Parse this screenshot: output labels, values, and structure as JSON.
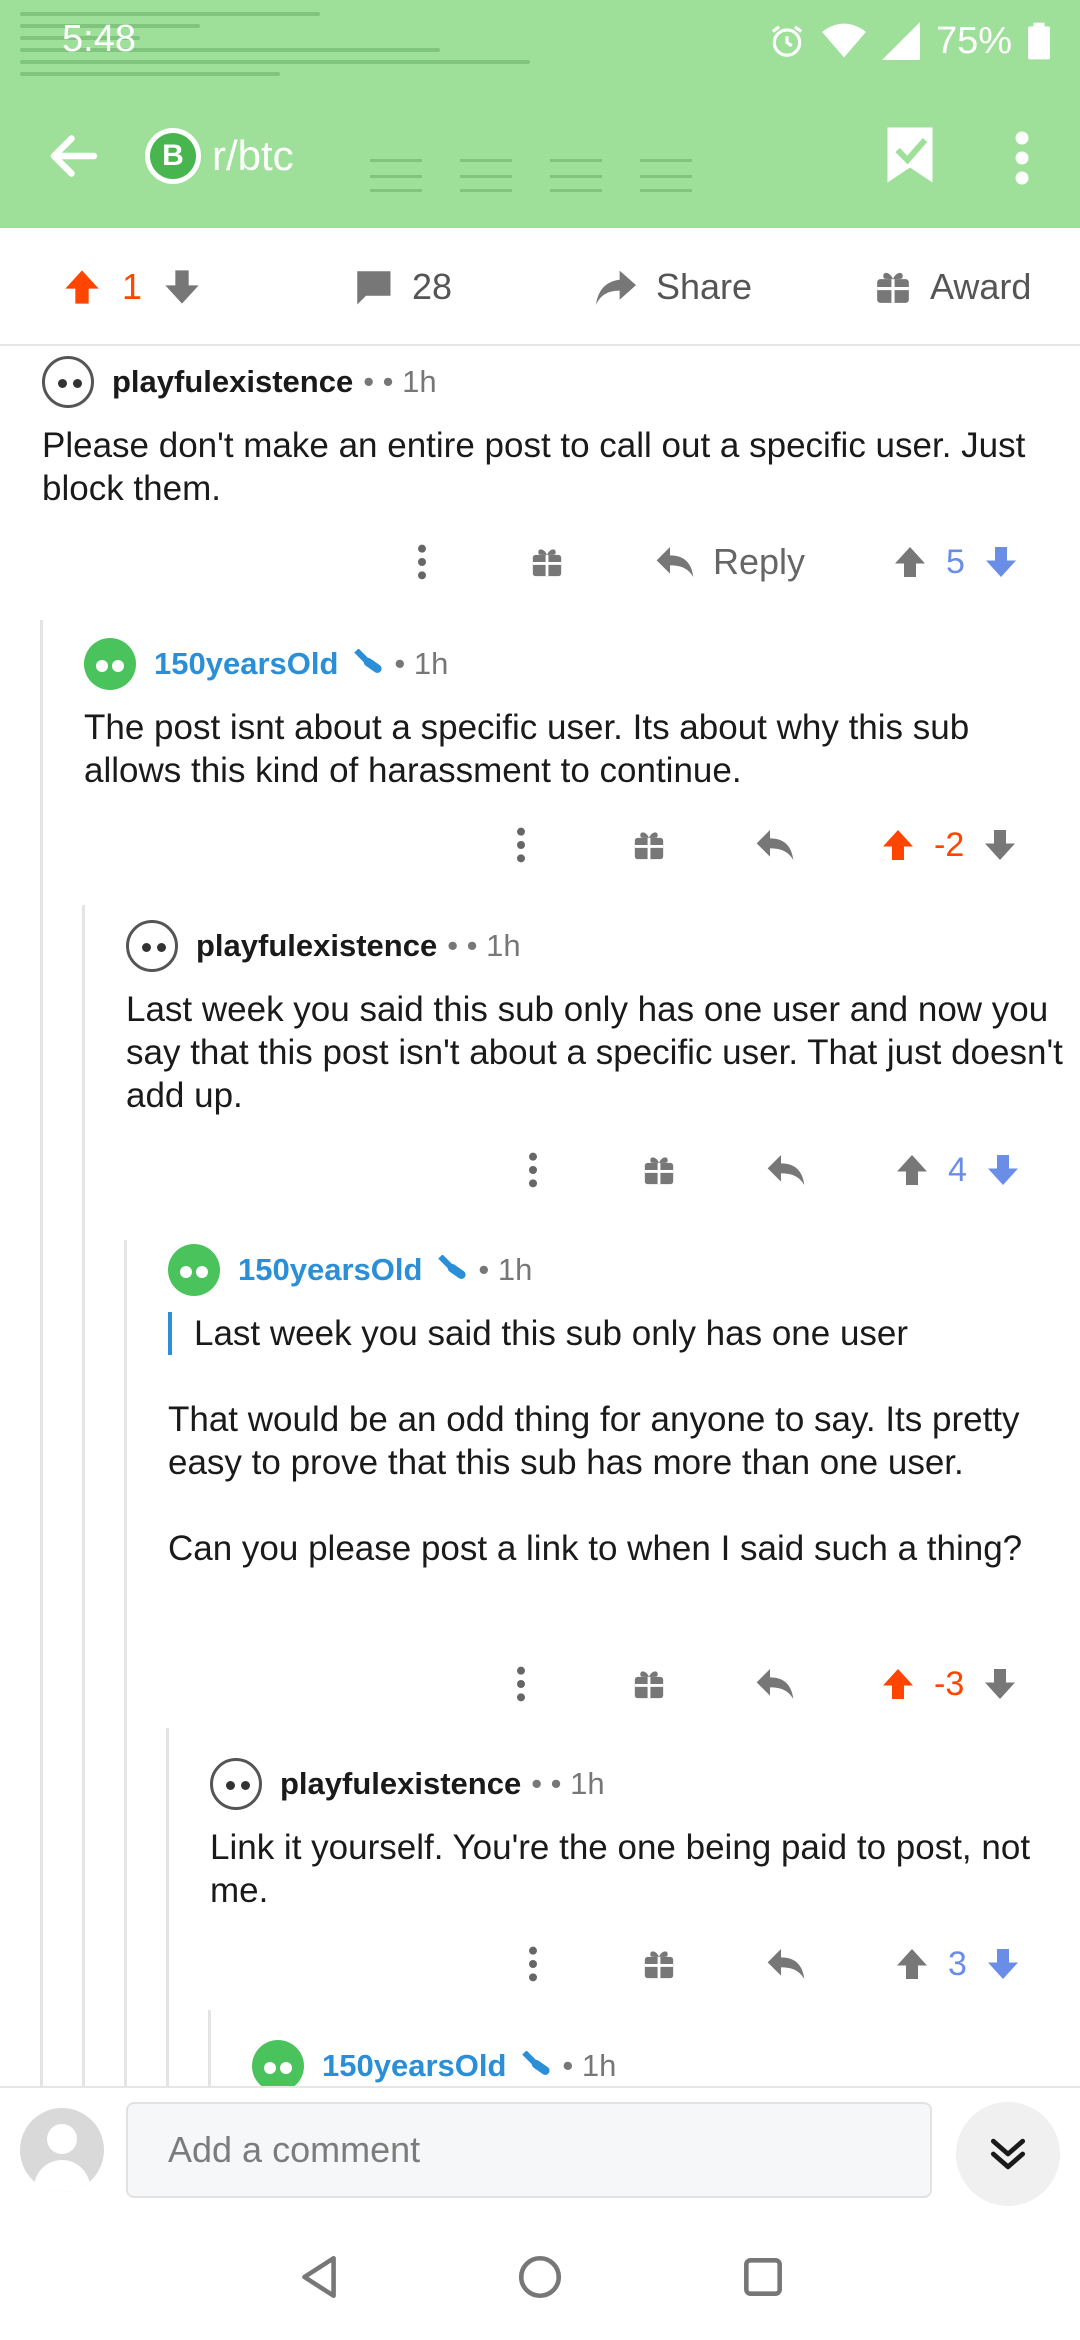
{
  "status": {
    "time": "5:48",
    "battery": "75%"
  },
  "toolbar": {
    "subreddit": "r/btc",
    "sub_icon_letter": "B"
  },
  "post_actions": {
    "score": "1",
    "comments": "28",
    "share_label": "Share",
    "award_label": "Award"
  },
  "comments": [
    {
      "author": "playfulexistence",
      "time": "• • 1h",
      "body": [
        "Please don't make an entire post to call out a specific user. Just block them."
      ],
      "score": "5",
      "reply_label": "Reply"
    },
    {
      "author": "150yearsOld",
      "time": "• 1h",
      "body": [
        "The post isnt about a specific user. Its about why this sub allows this kind of harassment to continue."
      ],
      "score": "-2"
    },
    {
      "author": "playfulexistence",
      "time": "• • 1h",
      "body": [
        "Last week you said this sub only has one user and now you say that this post isn't about a specific user. That just doesn't add up."
      ],
      "score": "4"
    },
    {
      "author": "150yearsOld",
      "time": "• 1h",
      "quote": "Last week you said this sub only has one user",
      "body": [
        "That would be an odd thing for anyone to say. Its pretty easy to prove that this sub has more than one user.",
        "Can you please post a link to when I said such a thing?"
      ],
      "score": "-3"
    },
    {
      "author": "playfulexistence",
      "time": "• • 1h",
      "body": [
        "Link it yourself. You're the one being paid to post, not me."
      ],
      "score": "3"
    },
    {
      "author": "150yearsOld",
      "time": "• 1h"
    }
  ],
  "composer": {
    "placeholder": "Add a comment"
  },
  "colors": {
    "header": "#9ee09a",
    "upvote": "#ff4500",
    "downvote": "#6a8ee8",
    "op": "#2a8fd6"
  }
}
